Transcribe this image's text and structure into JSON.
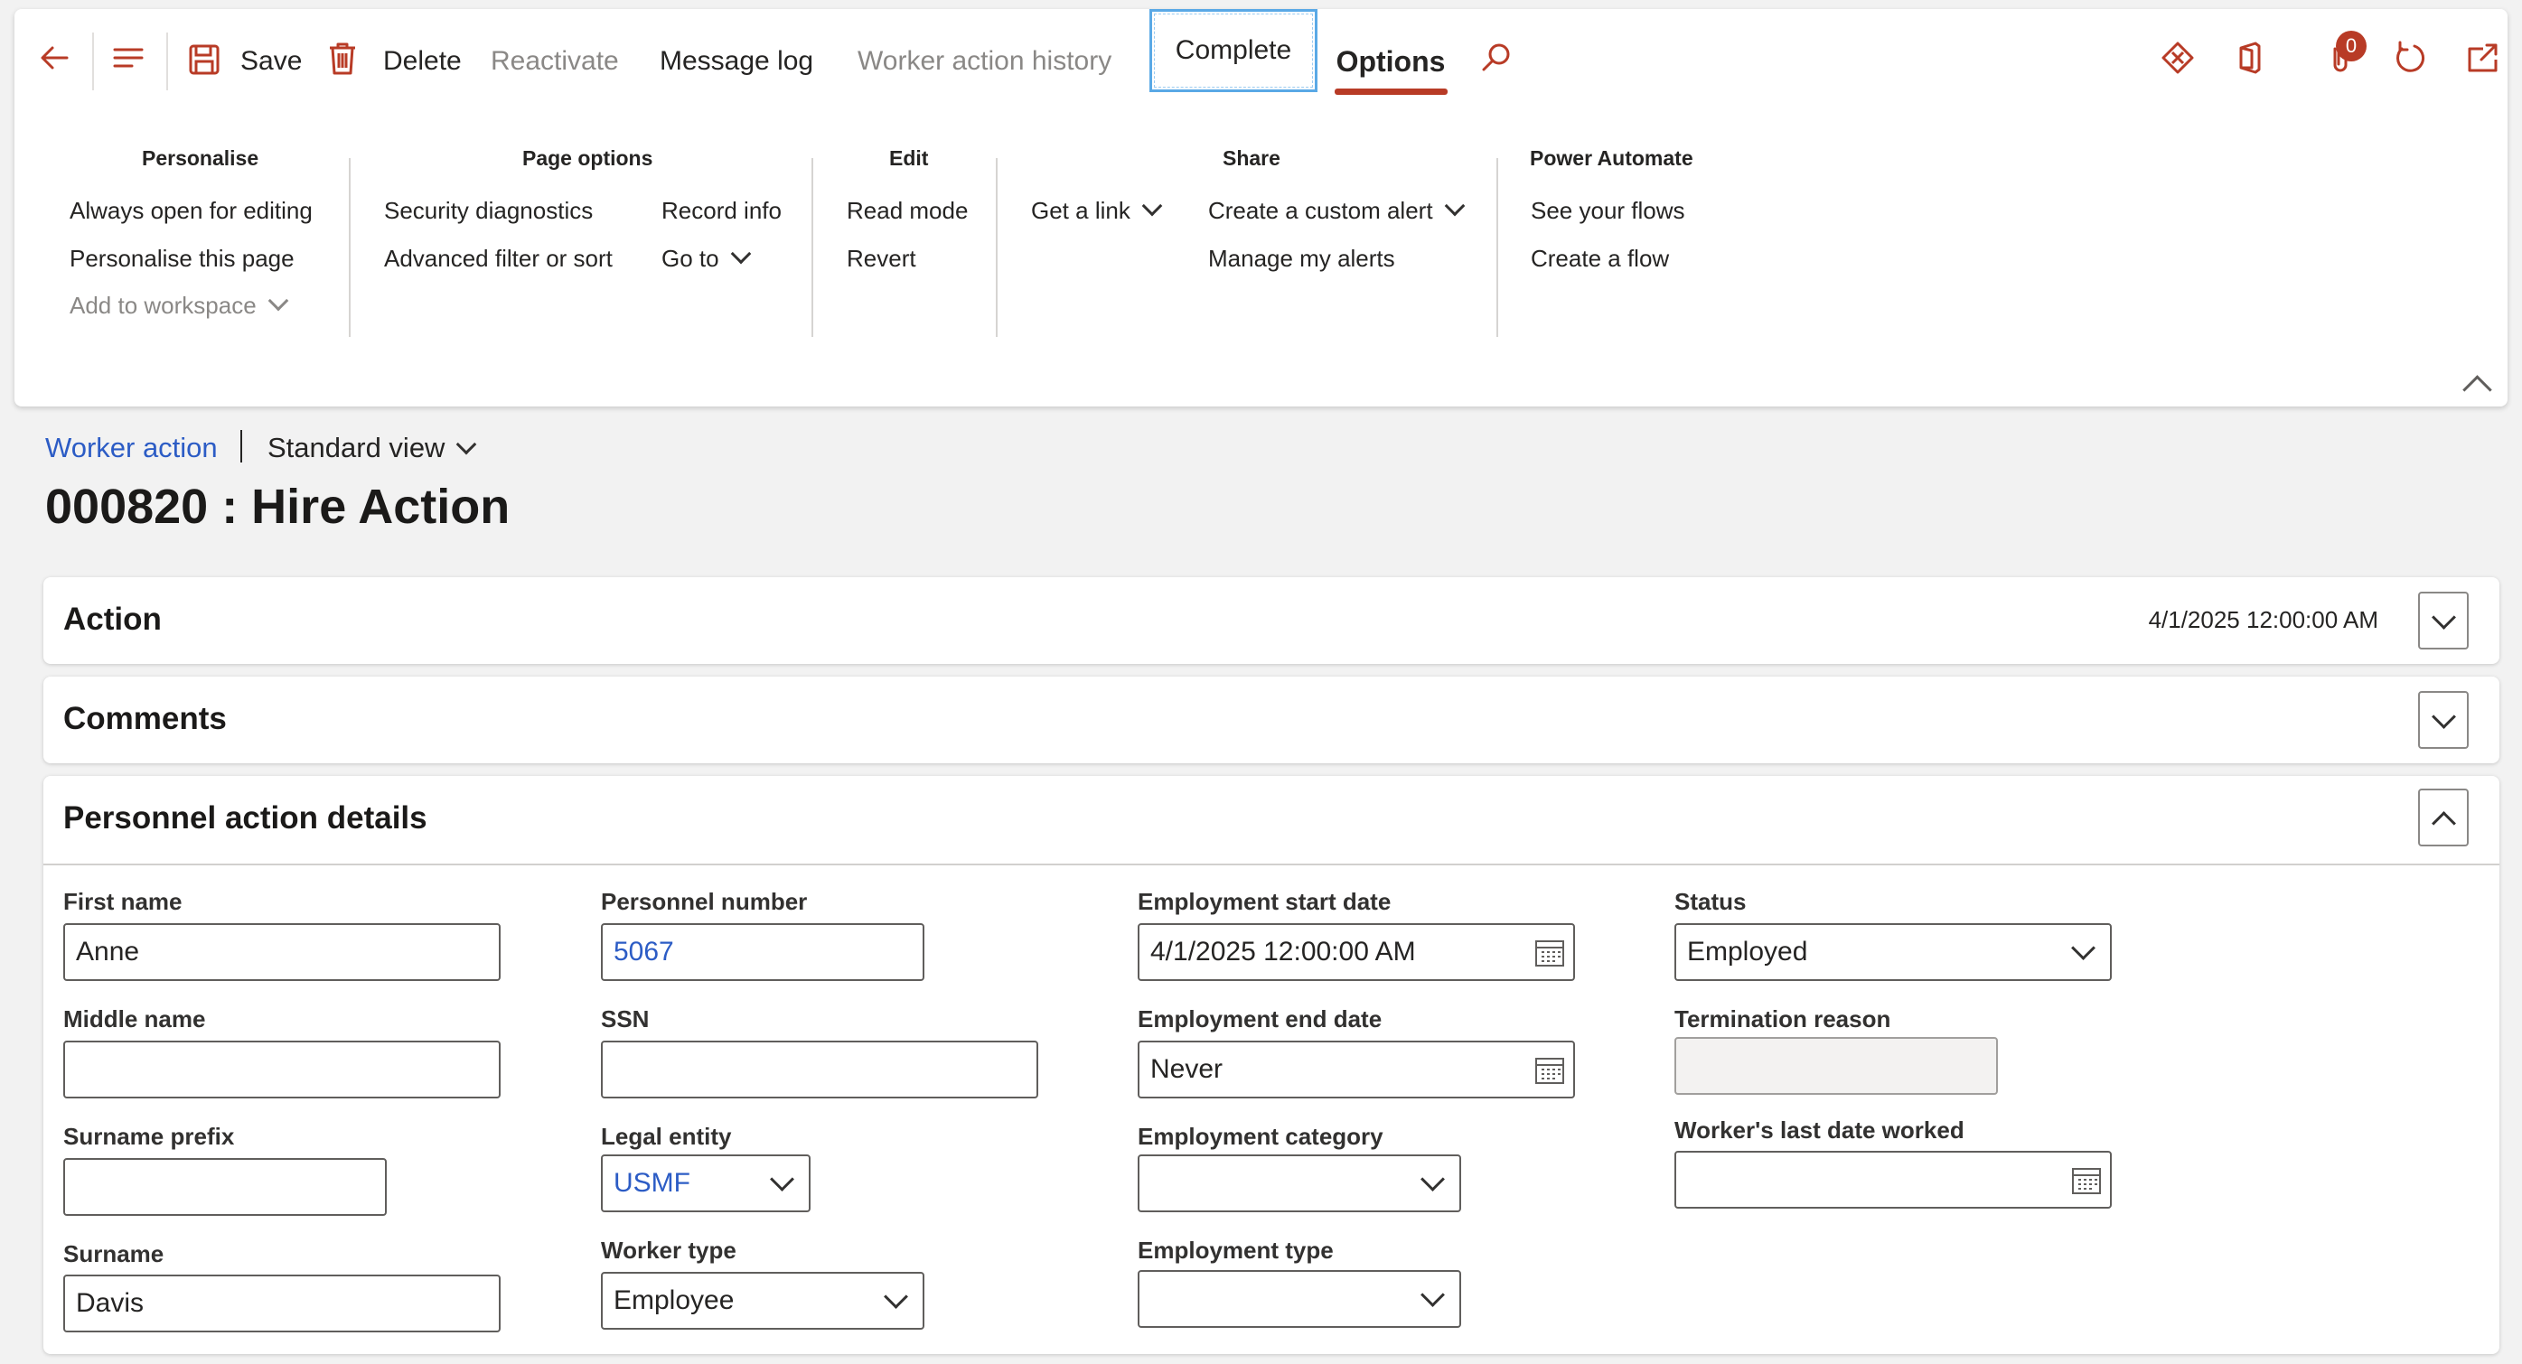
{
  "toolbar": {
    "save_label": "Save",
    "delete_label": "Delete",
    "reactivate_label": "Reactivate",
    "message_log_label": "Message log",
    "worker_action_history_label": "Worker action history",
    "complete_label": "Complete",
    "options_label": "Options",
    "attachments_count": "0"
  },
  "ribbon": {
    "groups": {
      "personalise": {
        "title": "Personalise",
        "items": [
          "Always open for editing",
          "Personalise this page",
          "Add to workspace"
        ]
      },
      "page_options": {
        "title": "Page options",
        "items": [
          "Security diagnostics",
          "Advanced filter or sort",
          "Record info",
          "Go to"
        ]
      },
      "edit": {
        "title": "Edit",
        "items": [
          "Read mode",
          "Revert"
        ]
      },
      "share": {
        "title": "Share",
        "items": [
          "Get a link",
          "Create a custom alert",
          "Manage my alerts"
        ]
      },
      "power_automate": {
        "title": "Power Automate",
        "items": [
          "See your flows",
          "Create a flow"
        ]
      }
    }
  },
  "header": {
    "breadcrumb": "Worker action",
    "view": "Standard view",
    "title": "000820 : Hire Action"
  },
  "sections": {
    "action": {
      "title": "Action",
      "summary": "4/1/2025 12:00:00 AM"
    },
    "comments": {
      "title": "Comments"
    },
    "details": {
      "title": "Personnel action details"
    }
  },
  "form": {
    "first_name": {
      "label": "First name",
      "value": "Anne"
    },
    "middle_name": {
      "label": "Middle name",
      "value": ""
    },
    "surname_prefix": {
      "label": "Surname prefix",
      "value": ""
    },
    "surname": {
      "label": "Surname",
      "value": "Davis"
    },
    "personnel_number": {
      "label": "Personnel number",
      "value": "5067"
    },
    "ssn": {
      "label": "SSN",
      "value": ""
    },
    "legal_entity": {
      "label": "Legal entity",
      "value": "USMF"
    },
    "worker_type": {
      "label": "Worker type",
      "value": "Employee"
    },
    "employment_start_date": {
      "label": "Employment start date",
      "value": "4/1/2025 12:00:00 AM"
    },
    "employment_end_date": {
      "label": "Employment end date",
      "value": "Never"
    },
    "employment_category": {
      "label": "Employment category",
      "value": ""
    },
    "employment_type": {
      "label": "Employment type",
      "value": ""
    },
    "status": {
      "label": "Status",
      "value": "Employed"
    },
    "termination_reason": {
      "label": "Termination reason",
      "value": ""
    },
    "last_date_worked": {
      "label": "Worker's last date worked",
      "value": ""
    }
  },
  "colors": {
    "accent": "#b83b26",
    "link": "#2c5cc5",
    "focus": "#5aa9e6"
  }
}
